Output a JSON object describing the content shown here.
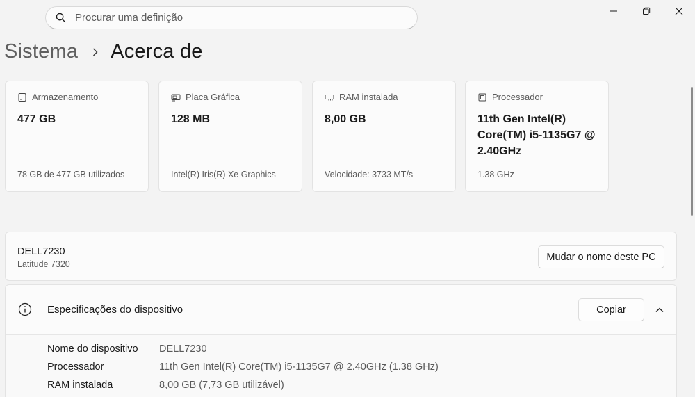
{
  "search": {
    "placeholder": "Procurar uma definição"
  },
  "breadcrumb": {
    "parent": "Sistema",
    "current": "Acerca de"
  },
  "cards": [
    {
      "icon": "storage-icon",
      "label": "Armazenamento",
      "value": "477 GB",
      "detail": "78 GB de 477 GB utilizados"
    },
    {
      "icon": "gpu-icon",
      "label": "Placa Gráfica",
      "value": "128 MB",
      "detail": "Intel(R) Iris(R) Xe Graphics"
    },
    {
      "icon": "ram-icon",
      "label": "RAM instalada",
      "value": "8,00 GB",
      "detail": "Velocidade: 3733 MT/s"
    },
    {
      "icon": "processor-icon",
      "label": "Processador",
      "value": "11th Gen Intel(R) Core(TM) i5-1135G7 @ 2.40GHz",
      "detail": "1.38 GHz"
    }
  ],
  "device": {
    "name": "DELL7230",
    "model": "Latitude 7320",
    "rename_label": "Mudar o nome deste PC"
  },
  "specs": {
    "title": "Especificações do dispositivo",
    "copy_label": "Copiar",
    "rows": [
      {
        "key": "Nome do dispositivo",
        "value": "DELL7230"
      },
      {
        "key": "Processador",
        "value": "11th Gen Intel(R) Core(TM) i5-1135G7 @ 2.40GHz (1.38 GHz)"
      },
      {
        "key": "RAM instalada",
        "value": "8,00 GB (7,73 GB utilizável)"
      }
    ]
  }
}
